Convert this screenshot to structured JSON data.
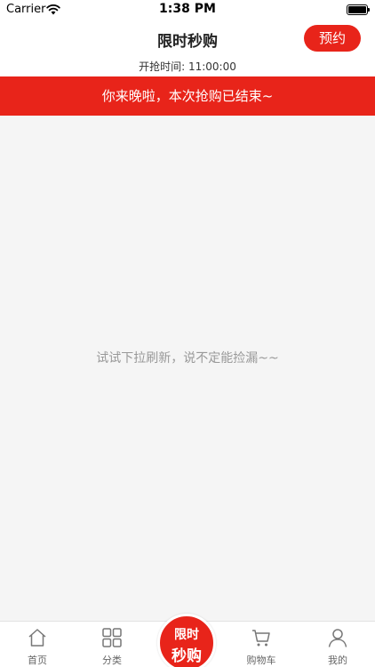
{
  "status_bar": {
    "carrier": "Carrier",
    "time": "1:38 PM"
  },
  "nav": {
    "title": "限时秒购",
    "reserve_label": "预约"
  },
  "start_time_text": "开抢时间: 11:00:00",
  "banner_text": "你来晚啦，本次抢购已结束~",
  "empty_hint": "试试下拉刷新，说不定能捡漏~~",
  "tabs": [
    {
      "label": "首页",
      "icon": "home-icon"
    },
    {
      "label": "分类",
      "icon": "grid-icon"
    },
    {
      "line1": "限时",
      "line2": "秒购"
    },
    {
      "label": "购物车",
      "icon": "cart-icon"
    },
    {
      "label": "我的",
      "icon": "user-icon"
    }
  ],
  "colors": {
    "accent": "#e8241a",
    "background": "#f5f5f5",
    "hint": "#999999"
  }
}
